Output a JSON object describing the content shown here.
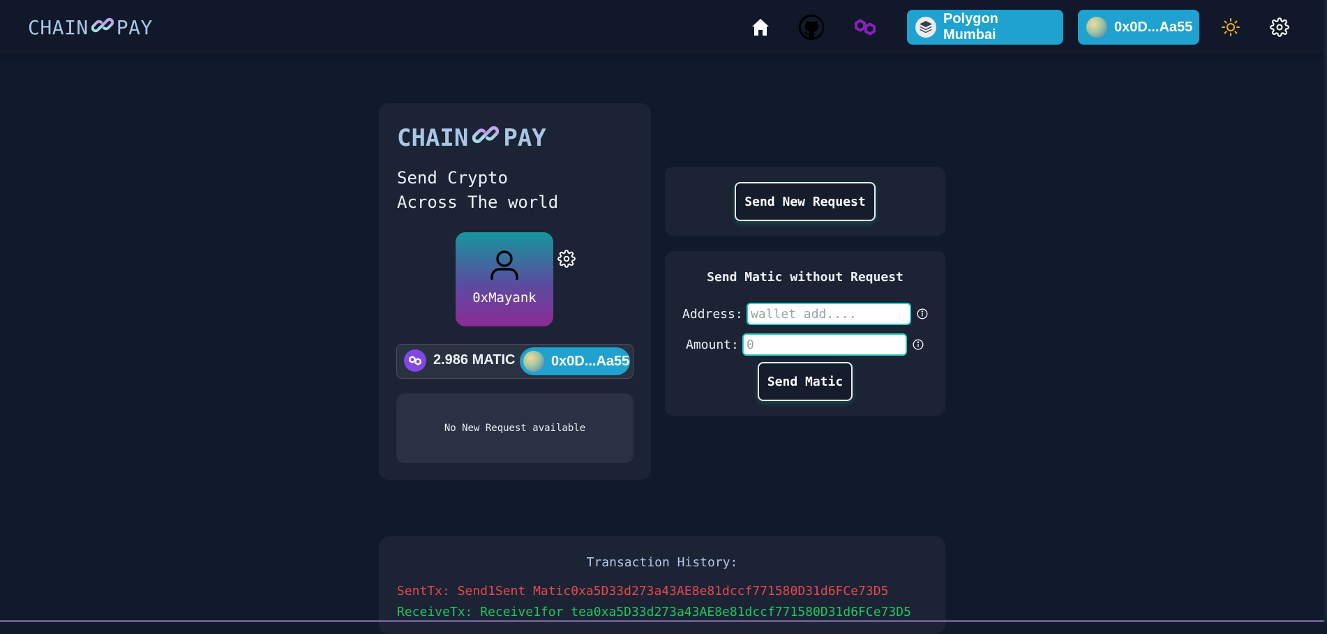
{
  "navbar": {
    "brand_left": "CHAIN",
    "brand_right": "PAY",
    "network_label": "Polygon Mumbai",
    "account_label": "0x0D...Aa55"
  },
  "profile_card": {
    "title_left": "CHAIN",
    "title_right": "PAY",
    "tagline_line1": "Send Crypto",
    "tagline_line2": "Across The world",
    "username": "0xMayank",
    "balance": "2.986 MATIC",
    "address": "0x0D...Aa55",
    "no_request_text": "No New Request available"
  },
  "request_card": {
    "button_label": "Send New Request"
  },
  "send_card": {
    "heading": "Send Matic without Request",
    "address_label": "Address:",
    "address_placeholder": "wallet add....",
    "amount_label": "Amount:",
    "amount_placeholder": "0",
    "send_button_label": "Send Matic"
  },
  "history": {
    "heading": "Transaction History:",
    "items": [
      {
        "text": "SentTx: Send1Sent Matic0xa5D33d273a43AE8e81dccf771580D31d6FCe73D5",
        "color": "#e5484d"
      },
      {
        "text": "ReceiveTx: Receive1for tea0xa5D33d273a43AE8e81dccf771580D31d6FCe73D5",
        "color": "#22c55e"
      }
    ]
  },
  "colors": {
    "accent": "#1fa2cf",
    "background": "#111a2c",
    "card": "#1b2335",
    "matic": "#8247e5"
  }
}
